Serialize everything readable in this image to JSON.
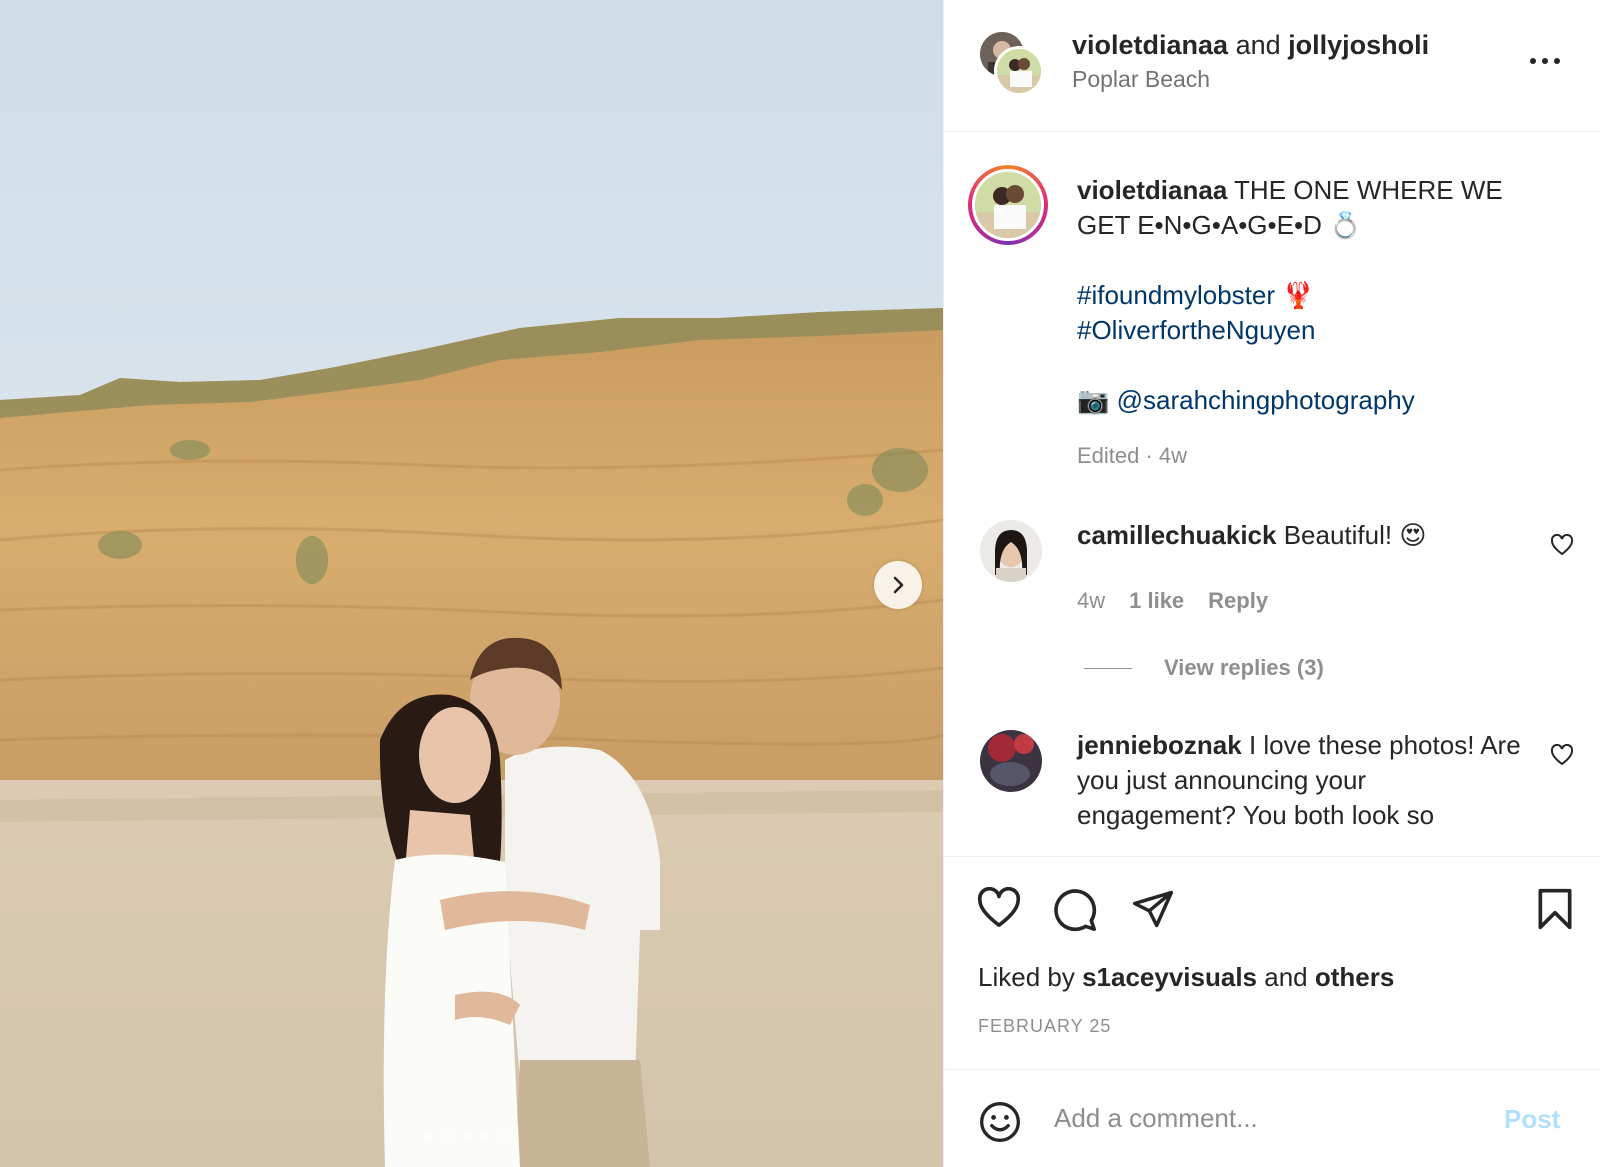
{
  "header": {
    "owner_1": "violetdianaa",
    "joiner": "and",
    "owner_2": "jollyjosholi",
    "location": "Poplar Beach"
  },
  "caption": {
    "username": "violetdianaa",
    "text": "THE ONE WHERE WE GET E•N•G•A•G•E•D 💍",
    "hashtag_1": "#ifoundmylobster",
    "hashtag_1_emoji": "🦞",
    "hashtag_2": "#OliverfortheNguyen",
    "credit_emoji": "📷",
    "credit": "@sarahchingphotography",
    "meta": "Edited · 4w"
  },
  "comments": [
    {
      "username": "camillechuakick",
      "text": "Beautiful! 😍",
      "time": "4w",
      "likes": "1 like",
      "reply": "Reply",
      "view_replies": "View replies (3)"
    },
    {
      "username": "jennieboznak",
      "text": "I love these photos! Are you just announcing your engagement? You both look so"
    }
  ],
  "likes": {
    "prefix": "Liked by",
    "user": "s1aceyvisuals",
    "joiner": "and",
    "others": "others"
  },
  "date": "FEBRUARY 25",
  "add_comment": {
    "placeholder": "Add a comment...",
    "post_label": "Post"
  },
  "carousel": {
    "slide_count": 5,
    "active_index": 0
  },
  "icons": {
    "next": "chevron-right-icon",
    "more": "more-icon",
    "like": "heart-icon",
    "comment": "comment-icon",
    "share": "send-icon",
    "save": "bookmark-icon",
    "emoji": "emoji-icon"
  },
  "colors": {
    "link": "#00376b",
    "muted": "#8e8e8e",
    "post_button_disabled": "#b2dffc"
  }
}
